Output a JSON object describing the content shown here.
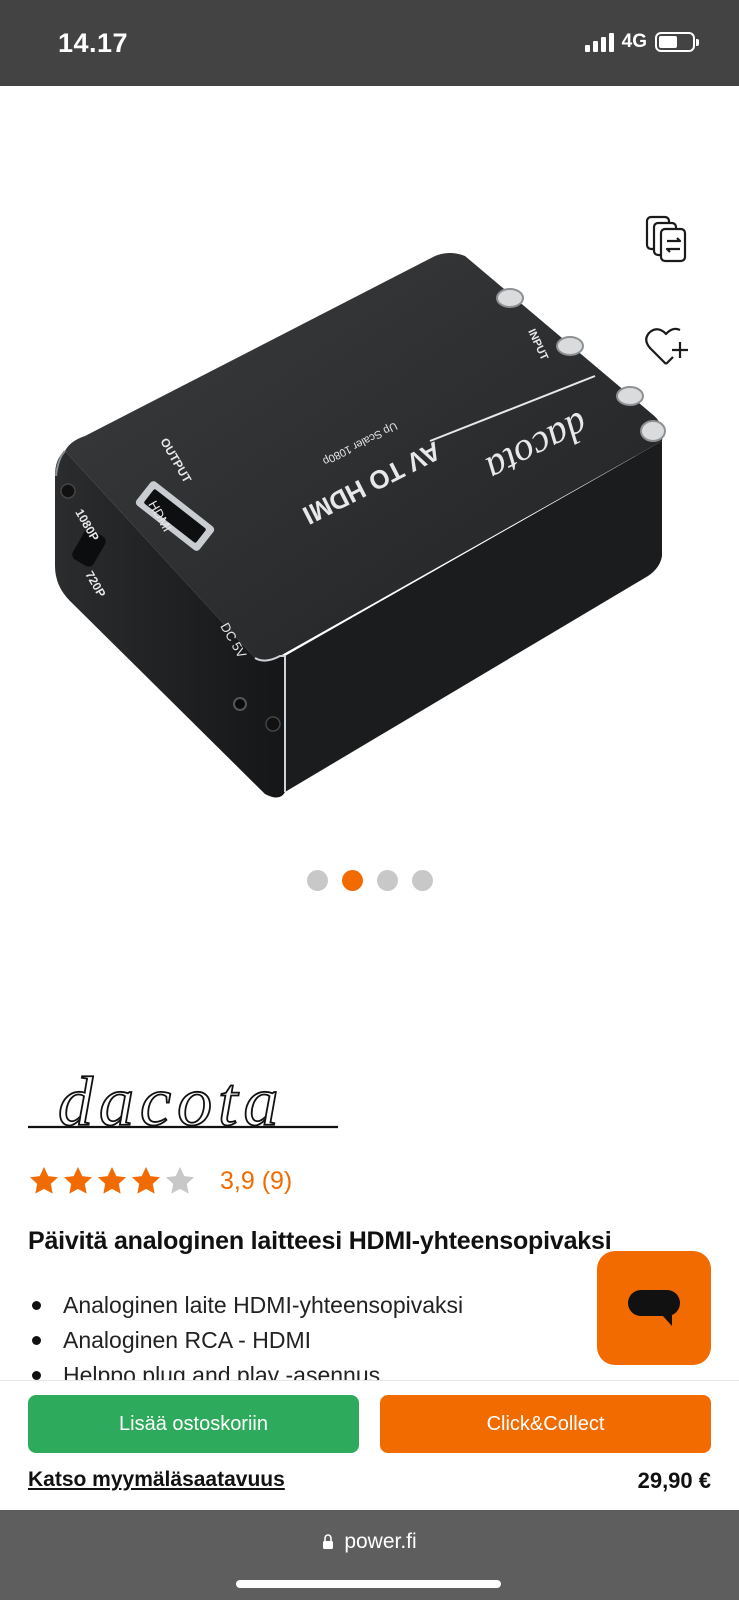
{
  "status_bar": {
    "time": "14.17",
    "network": "4G"
  },
  "gallery": {
    "image_count": 4,
    "active_index": 1,
    "device": {
      "brand_print": "dacota",
      "model_print": "AV TO HDMI",
      "sub_print": "Up Scaler 1080p",
      "port_input": "INPUT",
      "port_output": "OUTPUT",
      "port_hdmi": "HDMI",
      "port_power": "DC 5V",
      "switch_1080": "1080P",
      "switch_720": "720P"
    }
  },
  "product": {
    "brand": "dacota",
    "rating_stars": 3.9,
    "rating_text": "3,9 (9)",
    "title": "Päivitä analoginen laitteesi HDMI-yhteensopivaksi",
    "features": [
      "Analoginen laite HDMI-yhteensopivaksi",
      "Analoginen RCA - HDMI",
      "Helppo plug and play -asennus"
    ]
  },
  "actions": {
    "add_to_cart": "Lisää ostoskoriin",
    "click_collect": "Click&Collect",
    "store_availability": "Katso myymäläsaatavuus",
    "price": "29,90 €"
  },
  "browser": {
    "url": "power.fi"
  },
  "colors": {
    "accent": "#f26b00",
    "cart_green": "#2eaa5c",
    "status_bg": "#434343",
    "browser_bg": "#5e5e5e"
  }
}
